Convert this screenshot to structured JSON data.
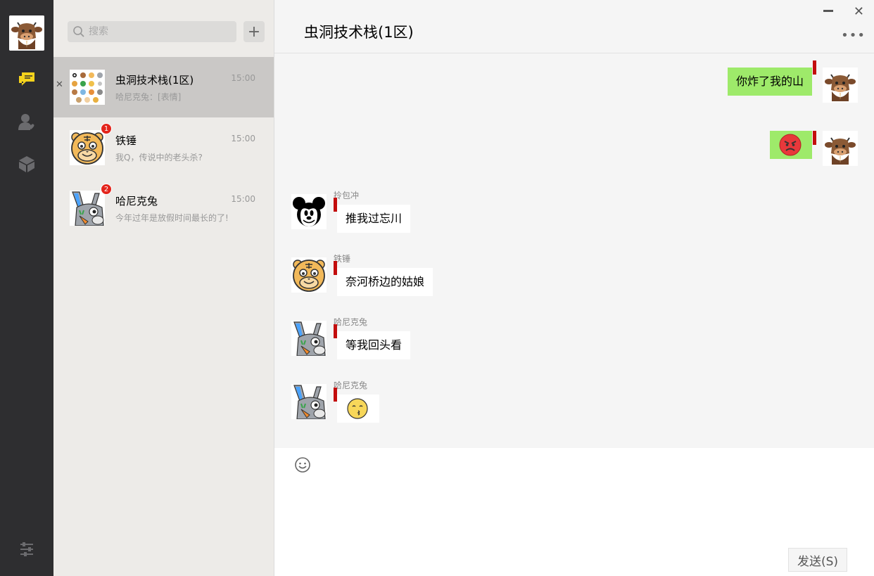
{
  "app": {
    "nav": {
      "me_icon": "cow-avatar",
      "items": [
        {
          "name": "chat",
          "icon": "chat-bubbles-icon",
          "active_color": "#f5d31c"
        },
        {
          "name": "contacts",
          "icon": "contact-person-icon"
        },
        {
          "name": "apps",
          "icon": "cube-icon"
        }
      ],
      "settings_icon": "sliders-icon"
    },
    "search": {
      "placeholder": "搜索",
      "add_button": "+"
    },
    "sessions": [
      {
        "name": "虫洞技术栈(1区)",
        "time": "15:00",
        "preview": "哈尼克兔：[表情]",
        "badge": "",
        "avatar": "animal-grid-avatar",
        "active": true
      },
      {
        "name": "铁锤",
        "time": "15:00",
        "preview": "我Q，传说中的老头杀?",
        "badge": "1",
        "avatar": "tiger-avatar"
      },
      {
        "name": "哈尼克兔",
        "time": "15:00",
        "preview": "今年过年是放假时间最长的了!",
        "badge": "2",
        "avatar": "rabbit-avatar"
      }
    ],
    "chat": {
      "title": "虫洞技术栈(1区)",
      "messages": [
        {
          "from": "me",
          "text": "你炸了我的山",
          "avatar": "cow-avatar"
        },
        {
          "from": "me",
          "text": "",
          "emoji": "angry-face",
          "avatar": "cow-avatar"
        },
        {
          "from": "拎包冲",
          "text": "推我过忘川",
          "avatar": "mickey-avatar"
        },
        {
          "from": "铁锤",
          "text": "奈河桥边的姑娘",
          "avatar": "tiger-avatar"
        },
        {
          "from": "哈尼克兔",
          "text": "等我回头看",
          "avatar": "rabbit-avatar"
        },
        {
          "from": "哈尼克兔",
          "text": "",
          "emoji": "kiss-face",
          "avatar": "rabbit-avatar"
        }
      ]
    },
    "composer": {
      "emoji_icon": "smile-icon",
      "send_label": "发送(S)"
    },
    "window": {
      "minimize": "—",
      "close": "✕",
      "more": "•••"
    }
  }
}
